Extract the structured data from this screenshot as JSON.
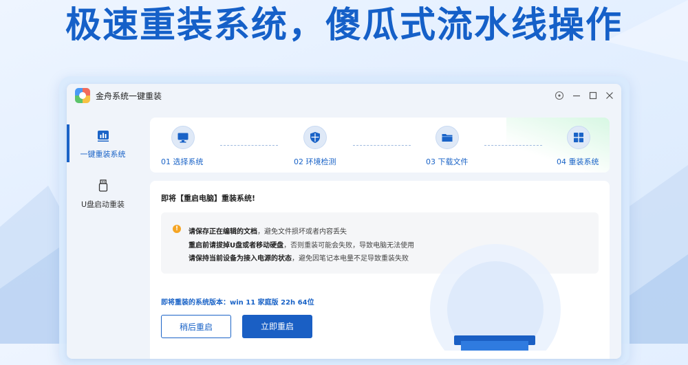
{
  "hero": {
    "title": "极速重装系统，傻瓜式流水线操作"
  },
  "window": {
    "title": "金舟系统一键重装",
    "controls": [
      "help-icon",
      "minimize-icon",
      "maximize-icon",
      "close-icon"
    ]
  },
  "sidebar": {
    "items": [
      {
        "label": "一键重装系统",
        "icon": "bar-chart-icon",
        "active": true
      },
      {
        "label": "U盘启动重装",
        "icon": "usb-drive-icon",
        "active": false
      }
    ]
  },
  "steps": [
    {
      "label": "01 选择系统",
      "icon": "monitor-icon"
    },
    {
      "label": "02 环境检测",
      "icon": "shield-icon"
    },
    {
      "label": "03 下载文件",
      "icon": "folder-icon"
    },
    {
      "label": "04 重装系统",
      "icon": "windows-icon"
    }
  ],
  "card": {
    "title": "即将【重启电脑】重装系统!",
    "notices": [
      {
        "bold": "请保存正在编辑的文档",
        "rest": "，避免文件损坏或者内容丢失"
      },
      {
        "bold": "重启前请拔掉U盘或者移动硬盘",
        "rest": "，否则重装可能会失败，导致电脑无法使用"
      },
      {
        "bold": "请保持当前设备为接入电源的状态",
        "rest": "，避免因笔记本电量不足导致重装失败"
      }
    ],
    "version": "即将重装的系统版本：win 11 家庭版 22h 64位",
    "buttons": {
      "later": "稍后重启",
      "now": "立即重启"
    }
  },
  "colors": {
    "accent": "#1a63c7",
    "hero": "#1560c8",
    "warning": "#f5a524"
  }
}
